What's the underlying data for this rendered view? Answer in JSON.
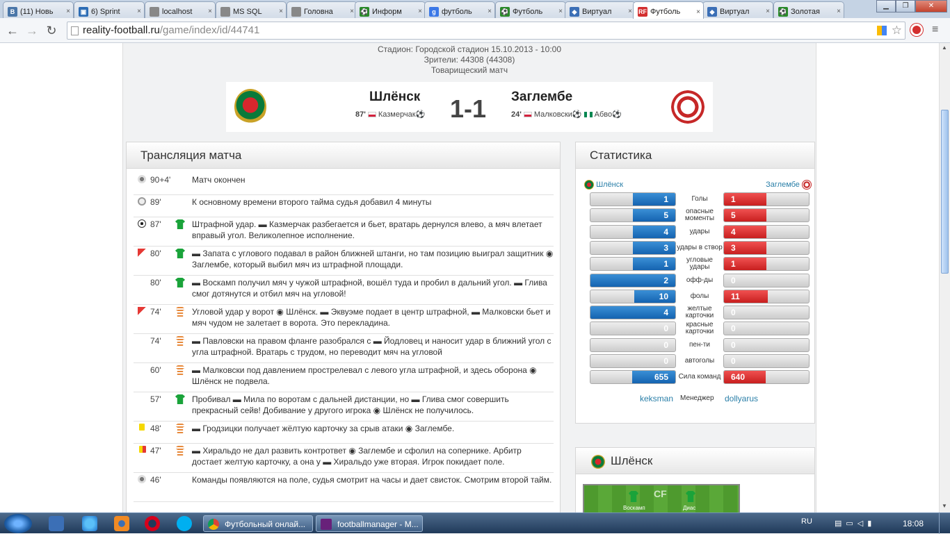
{
  "browser": {
    "tabs": [
      {
        "label": "(11) Новь",
        "color": "#4a76a8",
        "glyph": "B"
      },
      {
        "label": "6) Sprint",
        "color": "#2d6db5",
        "glyph": "▣"
      },
      {
        "label": "localhost",
        "color": "#888888",
        "glyph": ""
      },
      {
        "label": "MS SQL",
        "color": "#888888",
        "glyph": ""
      },
      {
        "label": "Головна",
        "color": "#888888",
        "glyph": ""
      },
      {
        "label": "Информ",
        "color": "#2a8a2a",
        "glyph": "⚽"
      },
      {
        "label": "футболь",
        "color": "#3b78e7",
        "glyph": "g"
      },
      {
        "label": "Футболь",
        "color": "#2a8a2a",
        "glyph": "⚽"
      },
      {
        "label": "Виртуал",
        "color": "#3b6fb6",
        "glyph": "◆"
      },
      {
        "label": "Футболь",
        "color": "#d32f2f",
        "glyph": "RF",
        "active": true
      },
      {
        "label": "Виртуал",
        "color": "#3b6fb6",
        "glyph": "◆"
      },
      {
        "label": "Золотая",
        "color": "#2a8a2a",
        "glyph": "⚽"
      }
    ],
    "url_domain": "reality-football.ru",
    "url_path": "/game/index/id/44741"
  },
  "match": {
    "stadium": "Стадион: Городской стадион 15.10.2013 - 10:00",
    "attendance": "Зрители: 44308 (44308)",
    "type": "Товарищеский матч",
    "home": "Шлёнск",
    "away": "Заглембе",
    "score": "1-1",
    "home_scorer_min": "87'",
    "home_scorer": "Казмерчак",
    "away_scorer_min": "24'",
    "away_scorer1": "Малковски",
    "away_scorer2": "Абво"
  },
  "broadcast": {
    "title": "Трансляция матча",
    "events": [
      {
        "icon": "whistle",
        "min": "90+4'",
        "shirt": "",
        "text": "Матч окончен"
      },
      {
        "icon": "clock",
        "min": "89'",
        "shirt": "",
        "text": "К основному времени второго тайма судья добавил 4 минуты"
      },
      {
        "icon": "ball",
        "min": "87'",
        "shirt": "green",
        "text": "Штрафной удар. ▬ Казмерчак разбегается и бьет, вратарь дернулся влево, а мяч влетает вправый угол. Великолепное исполнение."
      },
      {
        "icon": "corner",
        "min": "80'",
        "shirt": "green",
        "text": "▬ Запата с углового подавал в район ближней штанги, но там позицию выиграл защитник ◉ Заглембе, который выбил мяч из штрафной площади."
      },
      {
        "icon": "",
        "min": "80'",
        "shirt": "green",
        "text": "▬ Воскамп получил мяч у чужой штрафной, вошёл туда и пробил в дальний угол. ▬ Глива смог дотянутся и отбил мяч на угловой!"
      },
      {
        "icon": "corner",
        "min": "74'",
        "shirt": "orange",
        "text": "Угловой удар у ворот ◉ Шлёнск. ▬ Эквуэме подает в центр штрафной, ▬ Малковски бьет и мяч чудом не залетает в ворота. Это перекладина."
      },
      {
        "icon": "",
        "min": "74'",
        "shirt": "orange",
        "text": "▬ Павловски на правом фланге разобрался с ▬ Йодловец и наносит удар в ближний угол с угла штрафной. Вратарь с трудом, но переводит мяч на угловой"
      },
      {
        "icon": "",
        "min": "60'",
        "shirt": "orange",
        "text": "▬ Малковски под давлением прострелевал с левого угла штрафной, и здесь оборона ◉ Шлёнск не подвела."
      },
      {
        "icon": "",
        "min": "57'",
        "shirt": "green",
        "text": "Пробивал ▬ Мила по воротам с дальней дистанции, но ▬ Глива смог совершить прекрасный сейв! Добивание у другого игрока ◉ Шлёнск не получилось."
      },
      {
        "icon": "yellow",
        "min": "48'",
        "shirt": "orange",
        "text": "▬ Гродзицки получает жёлтую карточку за срыв атаки ◉ Заглембе."
      },
      {
        "icon": "yellowred",
        "min": "47'",
        "shirt": "orange",
        "text": "▬ Хиральдо не дал развить контрответ ◉ Заглембе и сфолил на сопернике. Арбитр достает желтую карточку, а она у ▬ Хиральдо уже вторая. Игрок покидает поле."
      },
      {
        "icon": "whistle",
        "min": "46'",
        "shirt": "",
        "text": "Команды появляются на поле, судья смотрит на часы и дает свисток. Смотрим второй тайм."
      }
    ]
  },
  "stats": {
    "title": "Статистика",
    "home": "Шлёнск",
    "away": "Заглембе",
    "rows": [
      {
        "label": "Голы",
        "home": 1,
        "away": 1,
        "hf": 0.5,
        "af": 0.5
      },
      {
        "label": "опасные моменты",
        "home": 5,
        "away": 5,
        "hf": 0.5,
        "af": 0.5
      },
      {
        "label": "удары",
        "home": 4,
        "away": 4,
        "hf": 0.5,
        "af": 0.5
      },
      {
        "label": "удары в створ",
        "home": 3,
        "away": 3,
        "hf": 0.5,
        "af": 0.5
      },
      {
        "label": "угловые удары",
        "home": 1,
        "away": 1,
        "hf": 0.5,
        "af": 0.5
      },
      {
        "label": "офф-ды",
        "home": 2,
        "away": 0,
        "hf": 1.0,
        "af": 0
      },
      {
        "label": "фолы",
        "home": 10,
        "away": 11,
        "hf": 0.48,
        "af": 0.52
      },
      {
        "label": "желтые карточки",
        "home": 4,
        "away": 0,
        "hf": 1.0,
        "af": 0
      },
      {
        "label": "красные карточки",
        "home": 0,
        "away": 0,
        "hf": 0,
        "af": 0
      },
      {
        "label": "пен-ти",
        "home": 0,
        "away": 0,
        "hf": 0,
        "af": 0
      },
      {
        "label": "автоголы",
        "home": 0,
        "away": 0,
        "hf": 0,
        "af": 0
      },
      {
        "label": "Сила команд",
        "home": 655,
        "away": 640,
        "hf": 0.51,
        "af": 0.49
      }
    ],
    "manager_label": "Менеджер",
    "home_manager": "keksman",
    "away_manager": "dollyarus"
  },
  "lineup": {
    "title": "Шлёнск",
    "players": [
      "Воскамп",
      "Диас"
    ],
    "position": "CF"
  },
  "taskbar": {
    "items": [
      {
        "label": "Футбольный онлай...",
        "color": "#dd4b39"
      },
      {
        "label": "footballmanager - M...",
        "color": "#68217a"
      }
    ],
    "lang": "RU",
    "time": "18:08"
  }
}
